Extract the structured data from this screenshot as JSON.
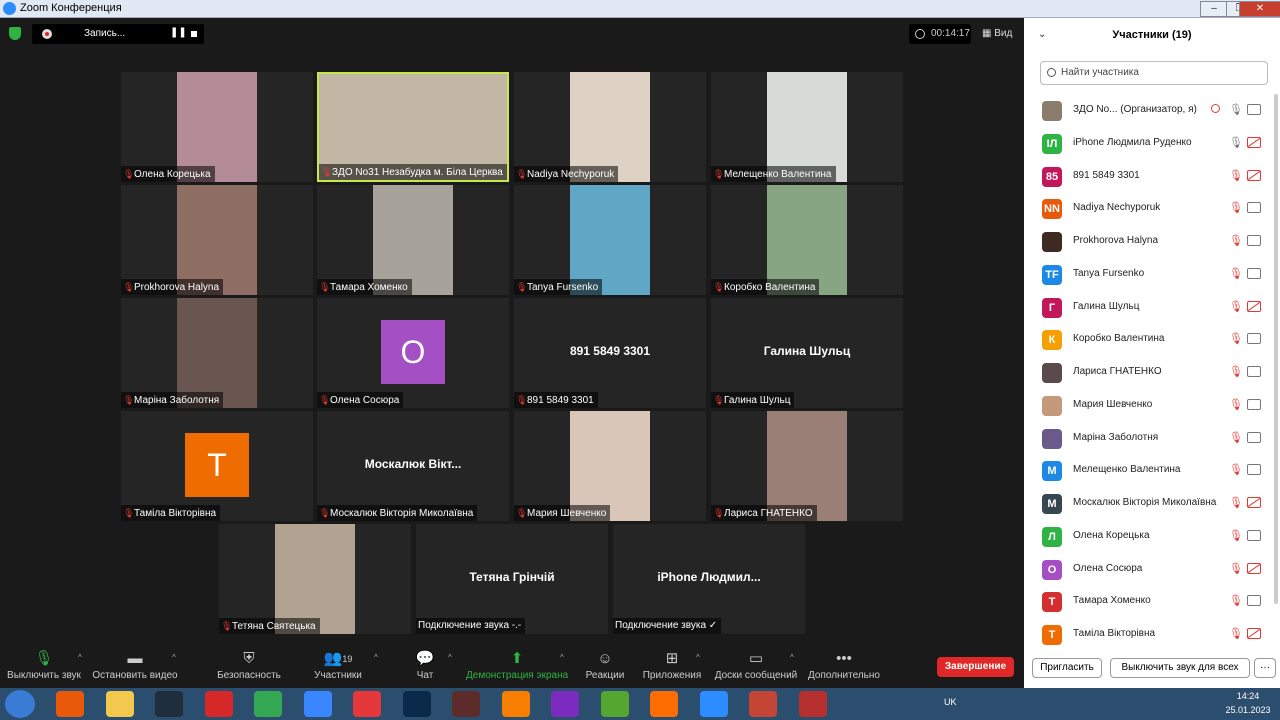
{
  "window": {
    "title": "Zoom Конференция",
    "min": "–",
    "max": "❐",
    "close": "✕"
  },
  "recording": {
    "label": "Запись...",
    "pause": "❚❚"
  },
  "timer": "00:14:17",
  "view_label": "Вид",
  "tiles": [
    {
      "name": "Олена Корецька",
      "type": "photo",
      "color": "#b38c97"
    },
    {
      "name": "ЗДО No31 Незабудка м. Біла Церква",
      "type": "photo",
      "color": "#c2b6a4",
      "active": true
    },
    {
      "name": "Nadiya Nechyporuk",
      "type": "photo",
      "color": "#ded2c5"
    },
    {
      "name": "Мелещенко Валентина",
      "type": "photo",
      "color": "#d8dcd9"
    },
    {
      "name": "Prokhorova Halyna",
      "type": "photo",
      "color": "#8f6e63"
    },
    {
      "name": "Тамара Хоменко",
      "type": "photo",
      "color": "#a7a39a"
    },
    {
      "name": "Tanya Fursenko",
      "type": "photo",
      "color": "#5fa7c4"
    },
    {
      "name": "Коробко Валентина",
      "type": "photo",
      "color": "#88a583"
    },
    {
      "name": "Маріна Заболотня",
      "type": "photo",
      "color": "#6a5650"
    },
    {
      "name": "Олена Сосюра",
      "type": "avatar",
      "letter": "О",
      "color": "#a44fc3"
    },
    {
      "name": "891 5849 3301",
      "type": "name",
      "display": "891 5849 3301"
    },
    {
      "name": "Галина Шульц",
      "type": "name",
      "display": "Галина Шульц"
    },
    {
      "name": "Таміла Вікторівна",
      "type": "avatar",
      "letter": "Т",
      "color": "#ef6c00"
    },
    {
      "name": "Москалюк Вікторія Миколаївна",
      "type": "name",
      "display": "Москалюк  Вікт..."
    },
    {
      "name": "Мария Шевченко",
      "type": "photo",
      "color": "#d9c6b8"
    },
    {
      "name": "Лариса ГНАТЕНКО",
      "type": "photo",
      "color": "#9a7f76"
    },
    {
      "name": "Тетяна Святецька",
      "type": "photo",
      "color": "#b2a292"
    },
    {
      "name": "Подключение звука -.-",
      "type": "name",
      "display": "Тетяна Грінчій"
    },
    {
      "name": "Подключение звука ✓",
      "type": "name",
      "display": "iPhone  Людмил..."
    }
  ],
  "toolbar": {
    "mute": "Выключить звук",
    "video": "Остановить видео",
    "security": "Безопасность",
    "participants": "Участники",
    "participants_count": "19",
    "chat": "Чат",
    "share": "Демонстрация экрана",
    "reactions": "Реакции",
    "apps": "Приложения",
    "whiteboards": "Доски сообщений",
    "more": "Дополнительно",
    "end": "Завершение"
  },
  "panel": {
    "title": "Участники (19)",
    "search_placeholder": "Найти участника",
    "invite": "Пригласить",
    "mute_all": "Выключить звук для всех",
    "more": "···",
    "participants": [
      {
        "name": "ЗДО No...   (Организатор, я)",
        "avatar": "",
        "color": "#8b7d6b",
        "mic": "on",
        "cam": "on",
        "host": true
      },
      {
        "name": "iPhone Людмила Руденко",
        "avatar": "IЛ",
        "color": "#2fb344",
        "mic": "on",
        "cam": "off"
      },
      {
        "name": "891 5849 3301",
        "avatar": "85",
        "color": "#c2185b",
        "mic": "off",
        "cam": "off"
      },
      {
        "name": "Nadiya Nechyporuk",
        "avatar": "NN",
        "color": "#e8590c",
        "mic": "off",
        "cam": "on"
      },
      {
        "name": "Prokhorova Halyna",
        "avatar": "",
        "color": "#3e2a22",
        "mic": "off",
        "cam": "on"
      },
      {
        "name": "Tanya Fursenko",
        "avatar": "TF",
        "color": "#1e88e5",
        "mic": "off",
        "cam": "on"
      },
      {
        "name": "Галина Шульц",
        "avatar": "Г",
        "color": "#c2185b",
        "mic": "off",
        "cam": "off"
      },
      {
        "name": "Коробко Валентина",
        "avatar": "К",
        "color": "#f59f00",
        "mic": "off",
        "cam": "on"
      },
      {
        "name": "Лариса ГНАТЕНКО",
        "avatar": "",
        "color": "#5a4a4a",
        "mic": "off",
        "cam": "on"
      },
      {
        "name": "Мария Шевченко",
        "avatar": "",
        "color": "#c49a7a",
        "mic": "off",
        "cam": "on"
      },
      {
        "name": "Маріна Заболотня",
        "avatar": "",
        "color": "#6a5a8a",
        "mic": "off",
        "cam": "on"
      },
      {
        "name": "Мелещенко Валентина",
        "avatar": "М",
        "color": "#1e88e5",
        "mic": "off",
        "cam": "on"
      },
      {
        "name": "Москалюк Вікторія Миколаївна",
        "avatar": "М",
        "color": "#37474f",
        "mic": "off",
        "cam": "off"
      },
      {
        "name": "Олена Корецька",
        "avatar": "Л",
        "color": "#2fb344",
        "mic": "off",
        "cam": "on"
      },
      {
        "name": "Олена Сосюра",
        "avatar": "О",
        "color": "#a44fc3",
        "mic": "off",
        "cam": "off"
      },
      {
        "name": "Тамара Хоменко",
        "avatar": "Т",
        "color": "#d32f2f",
        "mic": "off",
        "cam": "on"
      },
      {
        "name": "Таміла Вікторівна",
        "avatar": "Т",
        "color": "#ef6c00",
        "mic": "off",
        "cam": "off"
      }
    ]
  },
  "taskbar": {
    "lang": "UK",
    "time": "14:24",
    "date": "25.01.2023",
    "apps": [
      {
        "name": "media-player-icon",
        "color": "#e8590c"
      },
      {
        "name": "file-explorer-icon",
        "color": "#f2c94c"
      },
      {
        "name": "lightroom-icon",
        "color": "#1f2d3d"
      },
      {
        "name": "red-app-icon",
        "color": "#d62828"
      },
      {
        "name": "chrome-icon",
        "color": "#34a853"
      },
      {
        "name": "browser-icon",
        "color": "#3a86ff"
      },
      {
        "name": "opera-icon",
        "color": "#e5383b"
      },
      {
        "name": "photoshop-icon",
        "color": "#0b2a4a"
      },
      {
        "name": "video-editor-icon",
        "color": "#5e2b2b"
      },
      {
        "name": "media-icon",
        "color": "#f77f00"
      },
      {
        "name": "viber-icon",
        "color": "#7b2cbf"
      },
      {
        "name": "torrent-icon",
        "color": "#55a630"
      },
      {
        "name": "firefox-icon",
        "color": "#ff6d00"
      },
      {
        "name": "zoom-icon",
        "color": "#2d8cff"
      },
      {
        "name": "powerpoint-icon",
        "color": "#c44536"
      },
      {
        "name": "presentation-icon",
        "color": "#b5302f"
      }
    ]
  }
}
